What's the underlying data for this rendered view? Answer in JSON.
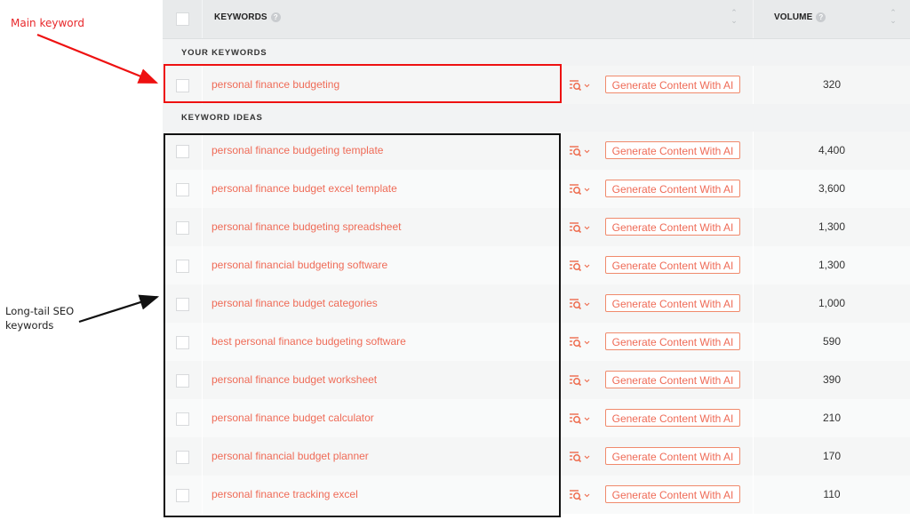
{
  "annotations": {
    "main_keyword": "Main keyword",
    "long_tail": [
      "Long-tail SEO",
      "keywords"
    ],
    "colors": {
      "main": "#e8282b",
      "long_tail": "#111111"
    }
  },
  "table": {
    "columns": {
      "keywords": "KEYWORDS",
      "volume": "VOLUME"
    },
    "sections": {
      "your_keywords": "YOUR KEYWORDS",
      "keyword_ideas": "KEYWORD IDEAS"
    },
    "action_label": "Generate Content With AI",
    "your_keywords": [
      {
        "keyword": "personal finance budgeting",
        "volume": "320"
      }
    ],
    "keyword_ideas": [
      {
        "keyword": "personal finance budgeting template",
        "volume": "4,400"
      },
      {
        "keyword": "personal finance budget excel template",
        "volume": "3,600"
      },
      {
        "keyword": "personal finance budgeting spreadsheet",
        "volume": "1,300"
      },
      {
        "keyword": "personal financial budgeting software",
        "volume": "1,300"
      },
      {
        "keyword": "personal finance budget categories",
        "volume": "1,000"
      },
      {
        "keyword": "best personal finance budgeting software",
        "volume": "590"
      },
      {
        "keyword": "personal finance budget worksheet",
        "volume": "390"
      },
      {
        "keyword": "personal finance budget calculator",
        "volume": "210"
      },
      {
        "keyword": "personal financial budget planner",
        "volume": "170"
      },
      {
        "keyword": "personal finance tracking excel",
        "volume": "110"
      }
    ],
    "accent": "#ef6b57"
  }
}
